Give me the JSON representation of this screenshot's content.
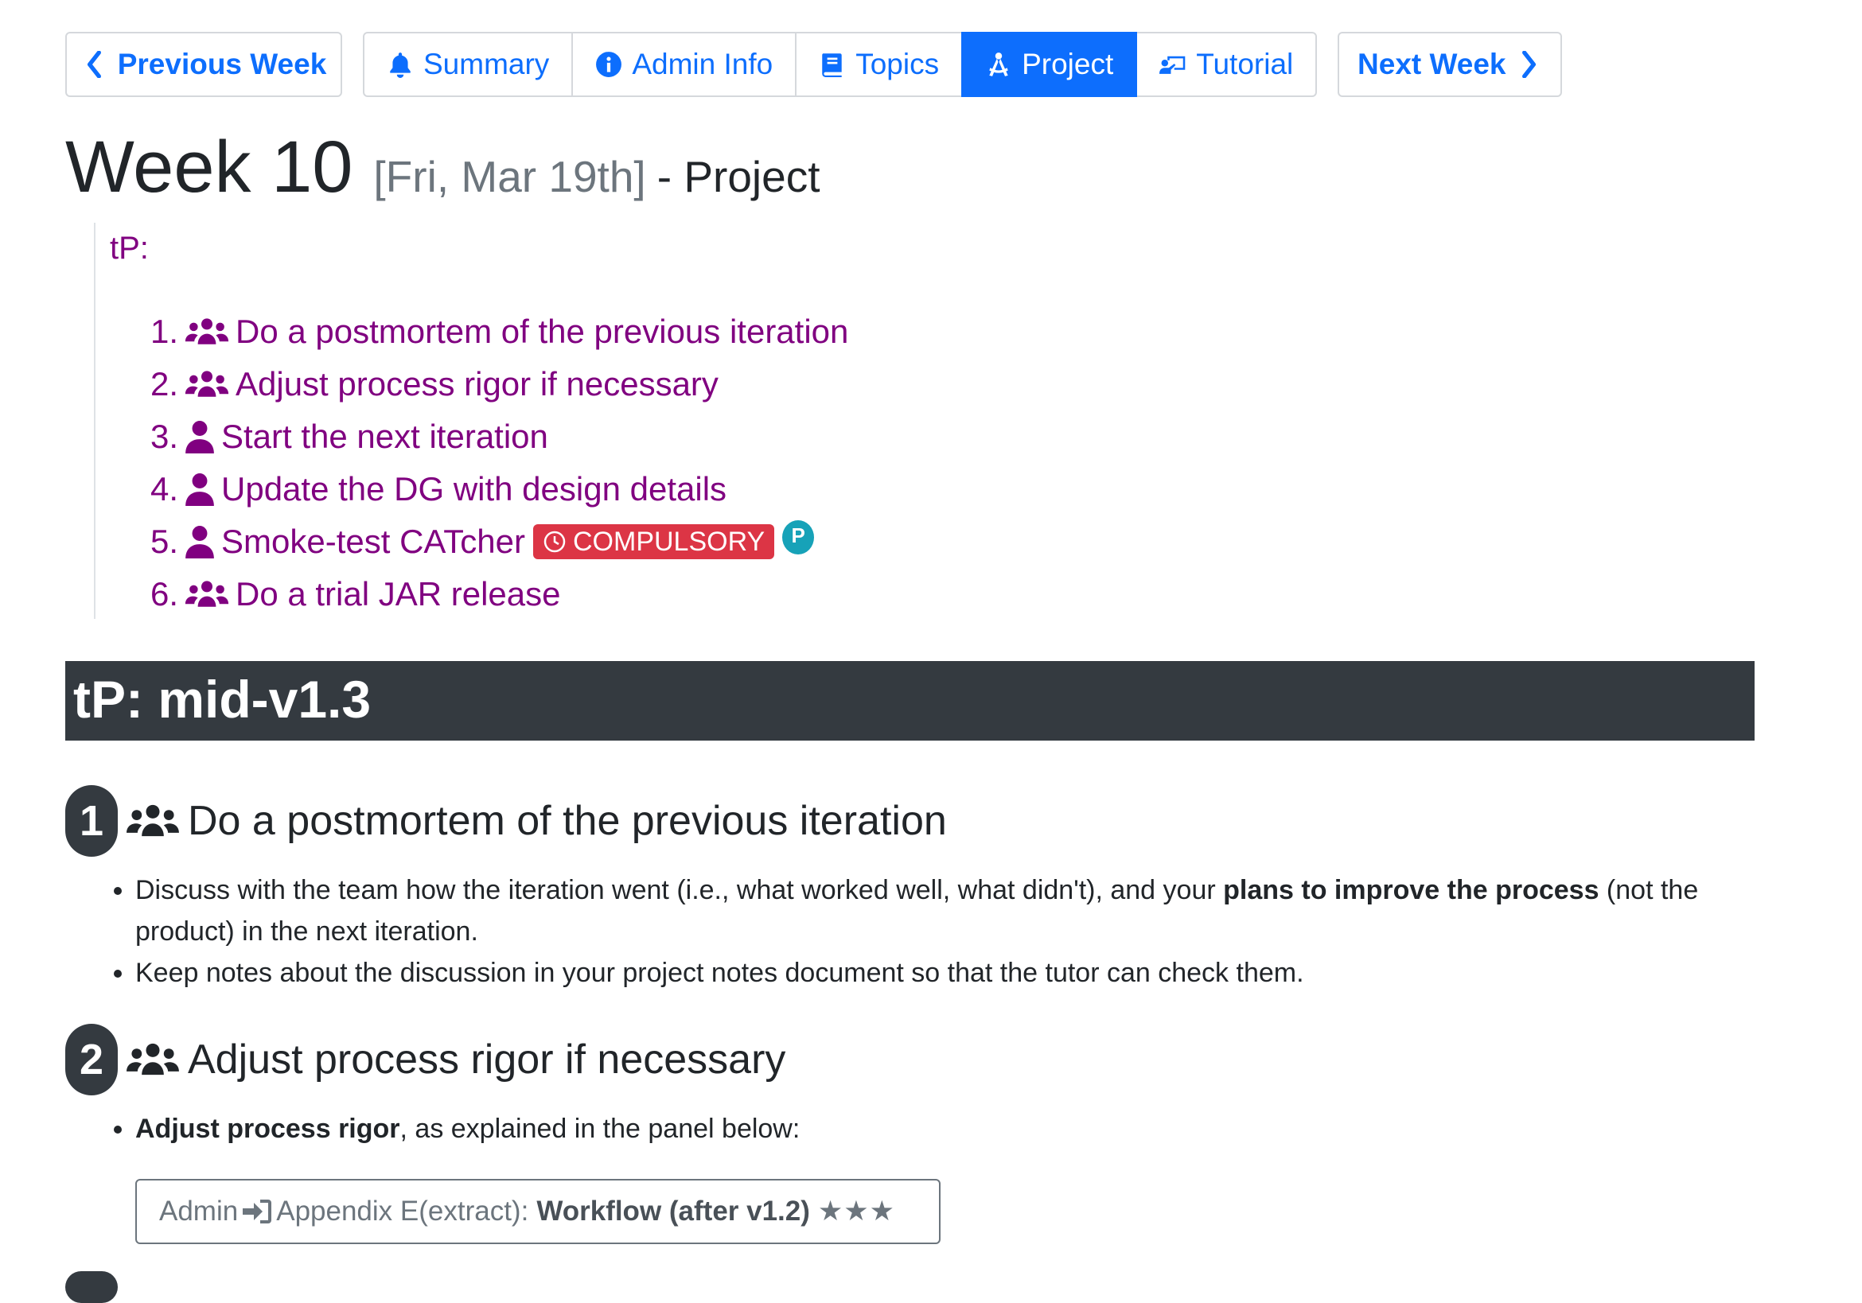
{
  "nav": {
    "prev": "Previous Week",
    "summary": "Summary",
    "admin": "Admin Info",
    "topics": "Topics",
    "project": "Project",
    "tutorial": "Tutorial",
    "next": "Next Week",
    "active_tab": "Project"
  },
  "heading": {
    "week": "Week 10",
    "date": "[Fri, Mar 19th]",
    "suffix": "- Project"
  },
  "tp": {
    "label": "tP:",
    "items": [
      {
        "num": "1.",
        "icon": "group-icon",
        "text": "Do a postmortem of the previous iteration"
      },
      {
        "num": "2.",
        "icon": "group-icon",
        "text": "Adjust process rigor if necessary"
      },
      {
        "num": "3.",
        "icon": "user-icon",
        "text": "Start the next iteration"
      },
      {
        "num": "4.",
        "icon": "user-icon",
        "text": "Update the DG with design details"
      },
      {
        "num": "5.",
        "icon": "user-icon",
        "text": "Smoke-test CATcher",
        "badge": "COMPULSORY",
        "pill": "P"
      },
      {
        "num": "6.",
        "icon": "group-icon",
        "text": "Do a trial JAR release"
      }
    ]
  },
  "section": {
    "title": "tP: mid-v1.3"
  },
  "steps": [
    {
      "num": "1",
      "title": "Do a postmortem of the previous iteration",
      "bullets": [
        {
          "pre": "Discuss with the team how the iteration went (i.e., what worked well, what didn't), and your ",
          "bold": "plans to improve the process",
          "post": " (not the product) in the next iteration."
        },
        {
          "text": "Keep notes about the discussion in your project notes document so that the tutor can check them."
        }
      ]
    },
    {
      "num": "2",
      "title": "Adjust process rigor if necessary",
      "bullets": [
        {
          "bold": "Adjust process rigor",
          "post": ", as explained in the panel below:"
        }
      ]
    }
  ],
  "panel": {
    "prefix": "Admin",
    "link": "Appendix E(extract):",
    "bold": "Workflow (after v1.2)",
    "stars": "★★★"
  },
  "colors": {
    "primary": "#0d6efd",
    "purple": "#800080",
    "dark": "#343a40",
    "danger": "#dc3545",
    "info": "#17a2b8"
  }
}
